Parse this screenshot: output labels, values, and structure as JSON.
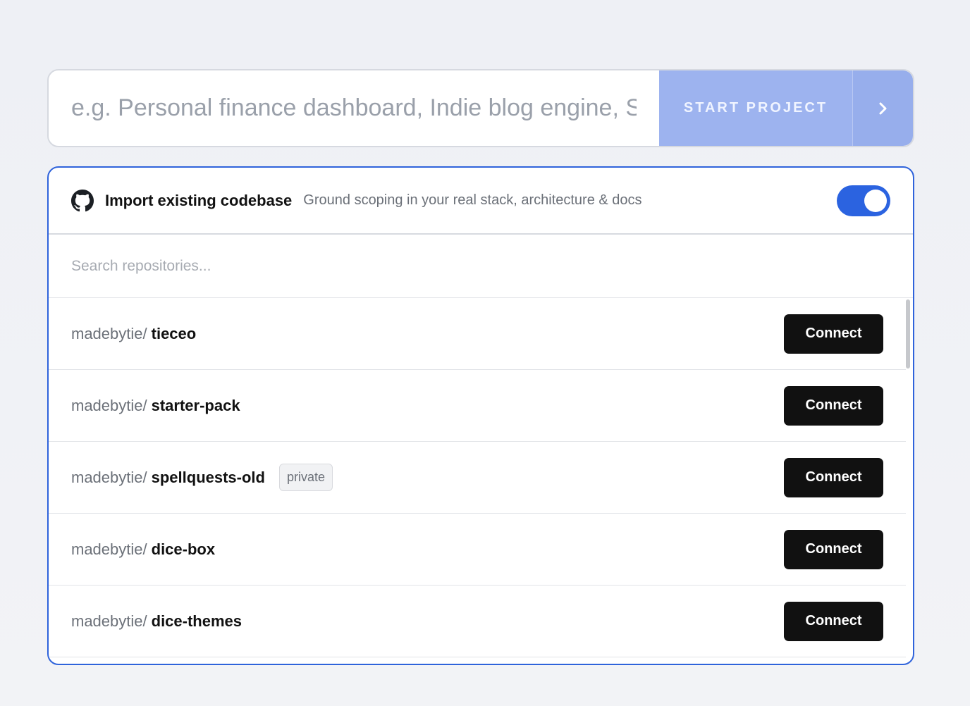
{
  "prompt": {
    "placeholder": "e.g. Personal finance dashboard, Indie blog engine, S",
    "start_label": "START PROJECT",
    "arrow_icon": "chevron-right-icon"
  },
  "import_panel": {
    "icon": "github-icon",
    "title": "Import existing codebase",
    "subtitle": "Ground scoping in your real stack, architecture & docs",
    "toggle_on": true,
    "accent_color": "#2b63e0",
    "search_placeholder": "Search repositories..."
  },
  "repos": [
    {
      "owner": "madebytie/",
      "name": "tieceo",
      "badge": "",
      "action": "Connect"
    },
    {
      "owner": "madebytie/",
      "name": "starter-pack",
      "badge": "",
      "action": "Connect"
    },
    {
      "owner": "madebytie/",
      "name": "spellquests-old",
      "badge": "private",
      "action": "Connect"
    },
    {
      "owner": "madebytie/",
      "name": "dice-box",
      "badge": "",
      "action": "Connect"
    },
    {
      "owner": "madebytie/",
      "name": "dice-themes",
      "badge": "",
      "action": "Connect"
    }
  ]
}
